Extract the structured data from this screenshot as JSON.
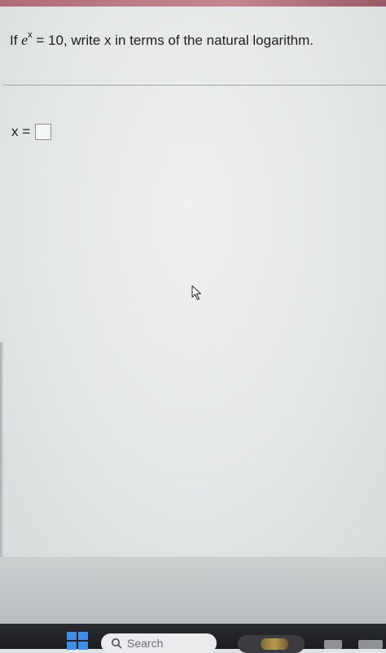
{
  "question": {
    "prefix": "If ",
    "base": "e",
    "exponent": "x",
    "suffix": " = 10, write x in terms of the natural logarithm."
  },
  "answer": {
    "label": "x ="
  },
  "taskbar": {
    "search_label": "Search"
  },
  "colors": {
    "accent_strip": "#b36a78",
    "windows_blue": "#3f8fe8",
    "taskbar": "#1b1d20"
  },
  "icons": {
    "cursor": "mouse-pointer-icon",
    "start": "windows-logo-icon",
    "search": "search-icon"
  }
}
